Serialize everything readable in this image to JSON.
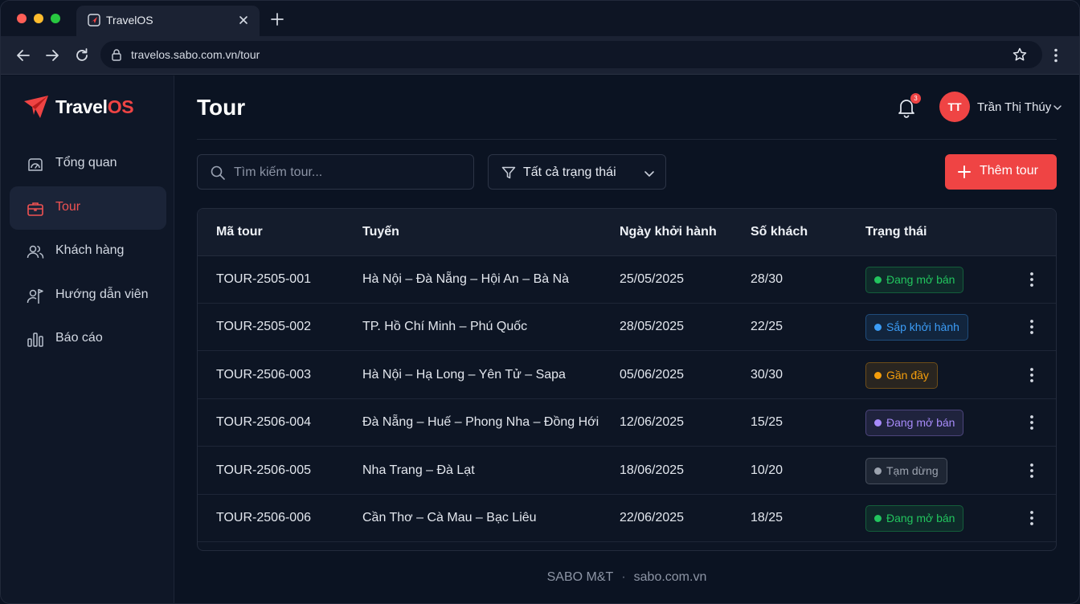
{
  "browser": {
    "tab_title": "TravelOS",
    "url": "travelos.sabo.com.vn/tour"
  },
  "brand": {
    "part1": "Travel",
    "part2": "OS",
    "accent": "#ef4444"
  },
  "sidebar": {
    "items": [
      {
        "label": "Tổng quan",
        "icon": "dashboard-icon"
      },
      {
        "label": "Tour",
        "icon": "briefcase-icon",
        "active": true
      },
      {
        "label": "Khách hàng",
        "icon": "users-icon"
      },
      {
        "label": "Hướng dẫn viên",
        "icon": "guide-icon"
      },
      {
        "label": "Báo cáo",
        "icon": "bar-chart-icon"
      }
    ]
  },
  "header": {
    "title": "Tour",
    "notifications": "3",
    "user_initials": "TT",
    "user_name": "Trần Thị Thúy"
  },
  "toolbar": {
    "search_placeholder": "Tìm kiếm tour...",
    "filter_label": "Tất cả trạng thái",
    "add_label": "Thêm tour"
  },
  "table": {
    "columns": [
      "Mã tour",
      "Tuyến",
      "Ngày khởi hành",
      "Số khách",
      "Trạng thái"
    ],
    "rows": [
      {
        "code": "TOUR-2505-001",
        "route": "Hà Nội – Đà Nẵng – Hội An – Bà Nà",
        "date": "25/05/2025",
        "guests": "28/30",
        "status": "Đang mở bán",
        "status_color": "#22c55e"
      },
      {
        "code": "TOUR-2505-002",
        "route": "TP. Hồ Chí Minh – Phú Quốc",
        "date": "28/05/2025",
        "guests": "22/25",
        "status": "Sắp khởi hành",
        "status_color": "#3b9cf6"
      },
      {
        "code": "TOUR-2506-003",
        "route": "Hà Nội – Hạ Long – Yên Tử – Sapa",
        "date": "05/06/2025",
        "guests": "30/30",
        "status": "Gần đầy",
        "status_color": "#f59e0b"
      },
      {
        "code": "TOUR-2506-004",
        "route": "Đà Nẵng – Huế – Phong Nha – Đồng Hới",
        "date": "12/06/2025",
        "guests": "15/25",
        "status": "Đang mở bán",
        "status_color": "#a78bfa"
      },
      {
        "code": "TOUR-2506-005",
        "route": "Nha Trang – Đà Lạt",
        "date": "18/06/2025",
        "guests": "10/20",
        "status": "Tạm dừng",
        "status_color": "#9ca3af"
      },
      {
        "code": "TOUR-2506-006",
        "route": "Cần Thơ – Cà Mau – Bạc Liêu",
        "date": "22/06/2025",
        "guests": "18/25",
        "status": "Đang mở bán",
        "status_color": "#22c55e"
      }
    ]
  },
  "footer": {
    "company": "SABO M&T",
    "separator": "·",
    "site": "sabo.com.vn"
  }
}
